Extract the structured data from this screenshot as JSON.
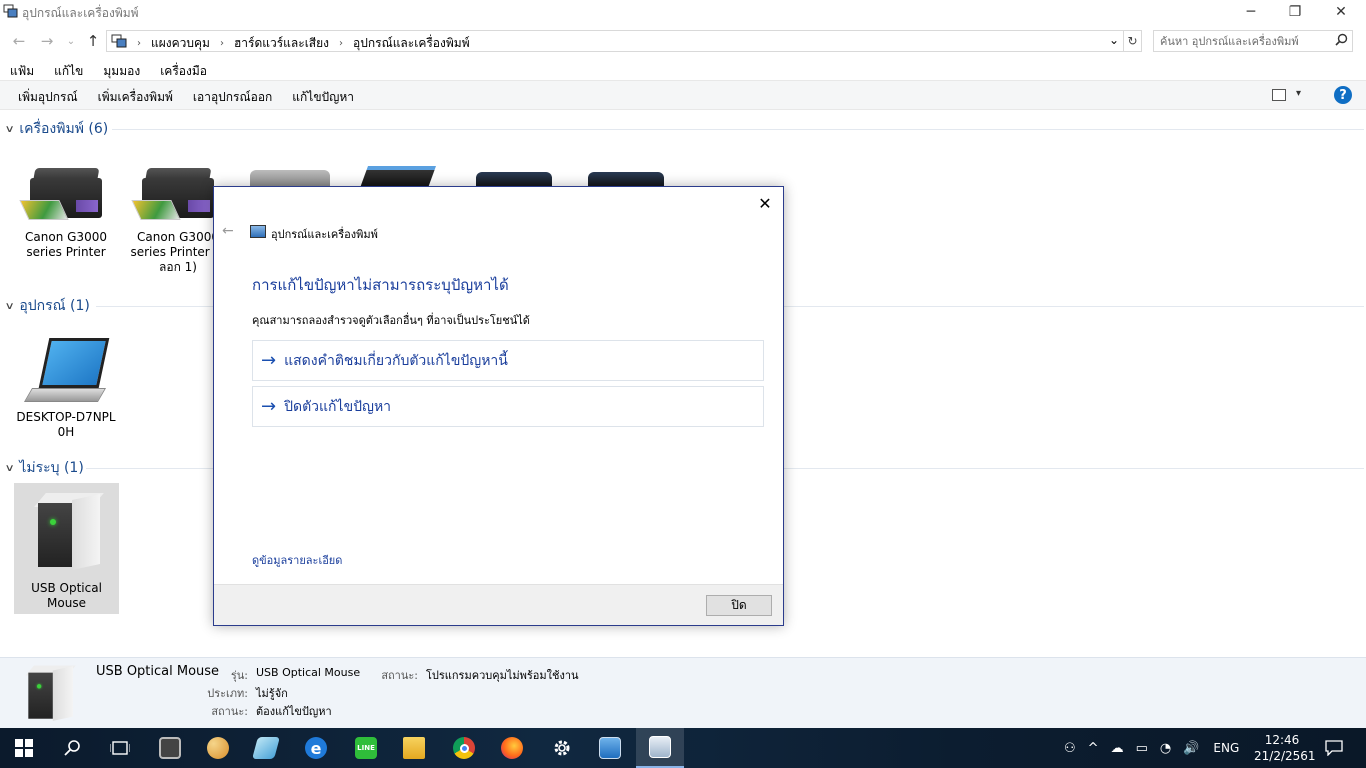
{
  "window": {
    "title": "อุปกรณ์และเครื่องพิมพ์",
    "minimize": "─",
    "restore": "❐",
    "close": "✕"
  },
  "nav": {
    "back": "←",
    "forward": "→",
    "recent": "⌄",
    "up": "↑",
    "breadcrumb": [
      "แผงควบคุม",
      "ฮาร์ดแวร์และเสียง",
      "อุปกรณ์และเครื่องพิมพ์"
    ],
    "breadcrumb_sep": "›",
    "dropdown": "⌄",
    "refresh": "↻"
  },
  "search": {
    "placeholder": "ค้นหา อุปกรณ์และเครื่องพิมพ์",
    "icon": "🔍"
  },
  "menubar": [
    "แฟ้ม",
    "แก้ไข",
    "มุมมอง",
    "เครื่องมือ"
  ],
  "commands": [
    "เพิ่มอุปกรณ์",
    "เพิ่มเครื่องพิมพ์",
    "เอาอุปกรณ์ออก",
    "แก้ไขปัญหา"
  ],
  "view_dropdown": "▾",
  "help": "?",
  "groups": {
    "printers": {
      "label": "เครื่องพิมพ์ (6)"
    },
    "devices": {
      "label": "อุปกรณ์ (1)"
    },
    "unspecified": {
      "label": "ไม่ระบุ (1)"
    },
    "chevron": "﹀"
  },
  "items": {
    "printer1": "Canon G3000 series Printer",
    "printer2": "Canon G3000 series Printer (ส ลอก 1)",
    "desktop": "DESKTOP-D7NPL 0H",
    "usb": "USB Optical Mouse"
  },
  "details": {
    "name": "USB Optical Mouse",
    "model_label": "รุ่น:",
    "model_value": "USB Optical Mouse",
    "category_label": "ประเภท:",
    "category_value": "ไม่รู้จัก",
    "status_label": "สถานะ:",
    "status_value": "ต้องแก้ไขปัญหา",
    "status2_label": "สถานะ:",
    "status2_value": "โปรแกรมควบคุมไม่พร้อมใช้งาน"
  },
  "dialog": {
    "title": "อุปกรณ์และเครื่องพิมพ์",
    "heading": "การแก้ไขปัญหาไม่สามารถระบุปัญหาได้",
    "subtitle": "คุณสามารถลองสำรวจดูตัวเลือกอื่นๆ ที่อาจเป็นประโยชน์ได้",
    "option1": "แสดงคำติชมเกี่ยวกับตัวแก้ไขปัญหานี้",
    "option2": "ปิดตัวแก้ไขปัญหา",
    "link": "ดูข้อมูลรายละเอียด",
    "close_button": "ปิด",
    "close_x": "✕",
    "back": "←",
    "arrow": "→"
  },
  "taskbar": {
    "start": "⊞",
    "search": "⚲",
    "taskview": "▭",
    "clock_time": "12:46",
    "clock_date": "21/2/2561",
    "lang": "ENG",
    "tray": [
      "⚇",
      "^",
      "☁",
      "▭",
      "◔",
      "🔊"
    ],
    "notification": "🗨"
  }
}
